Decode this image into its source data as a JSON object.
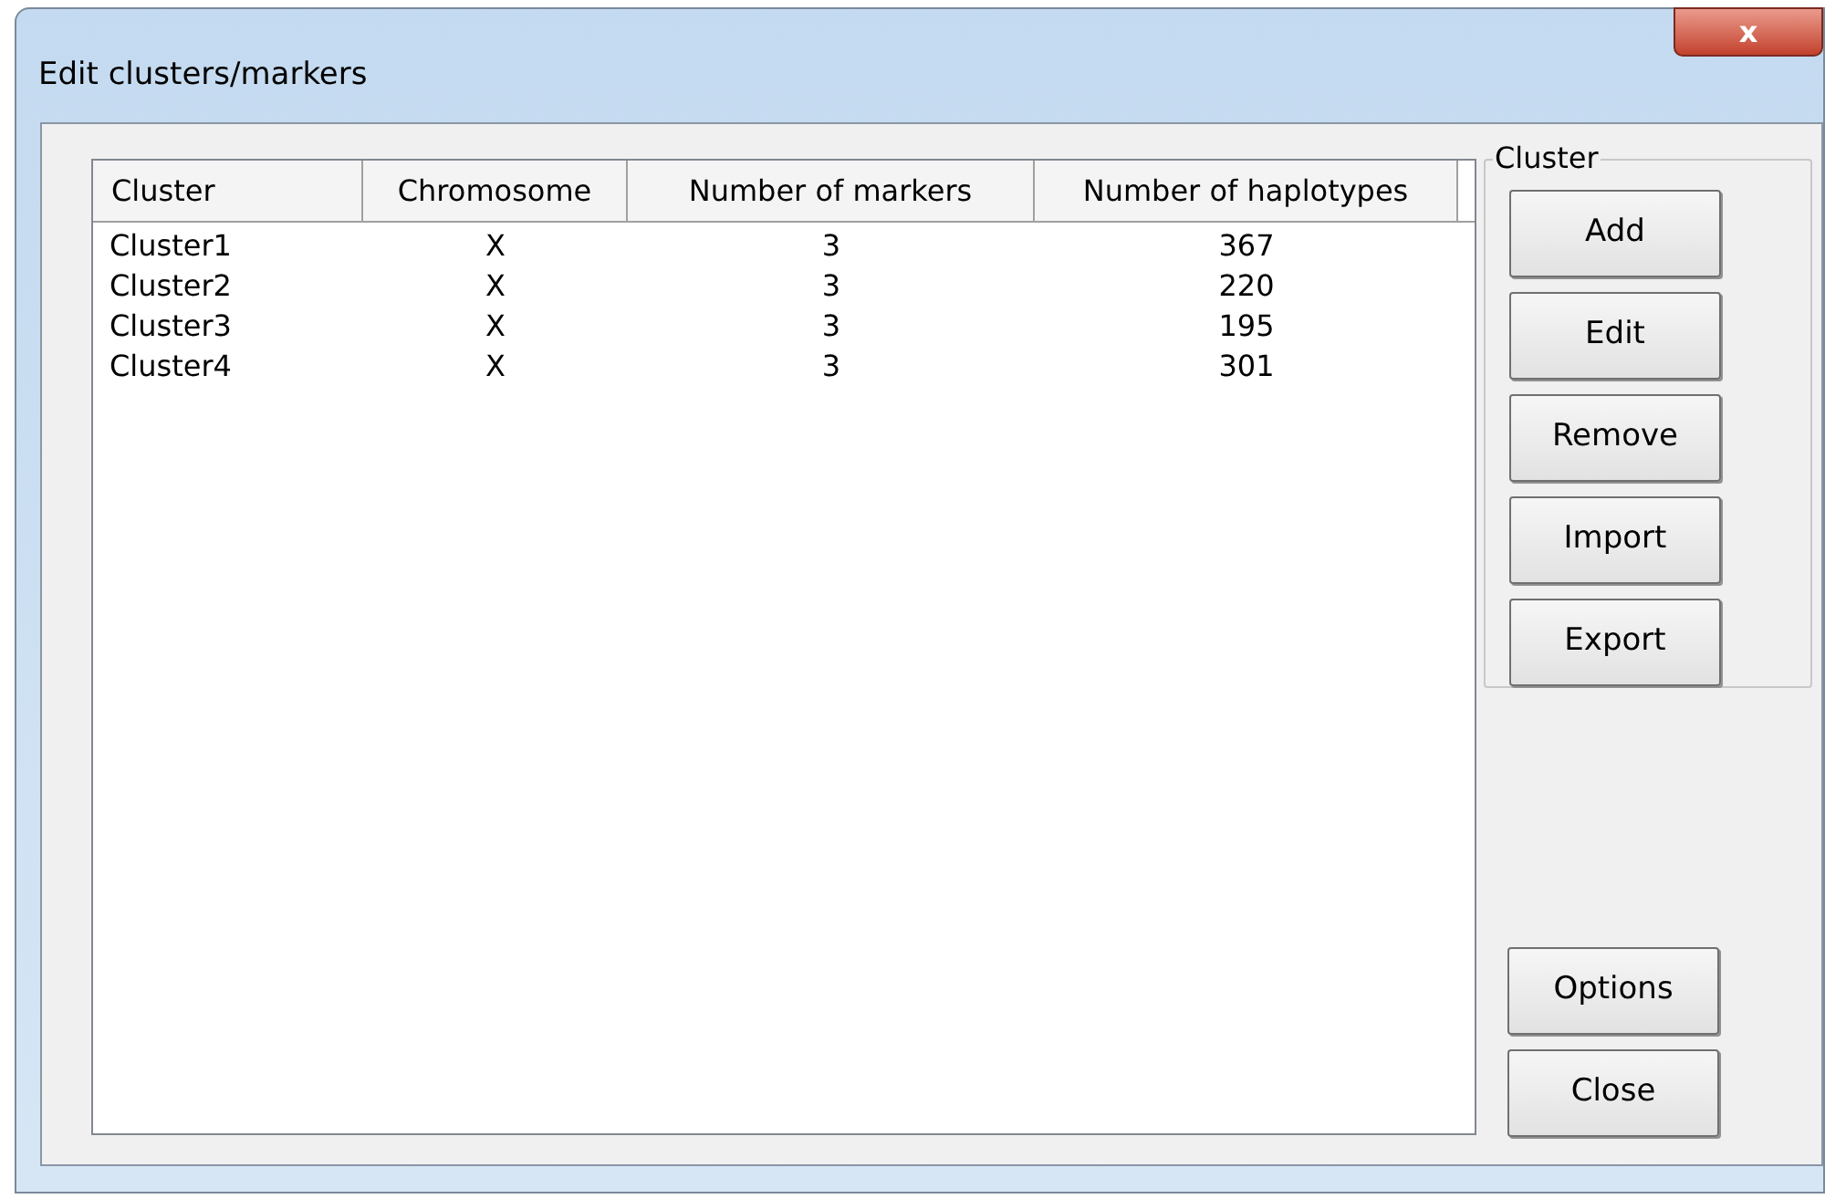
{
  "window": {
    "title": "Edit clusters/markers",
    "close_label": "x"
  },
  "table": {
    "columns": [
      "Cluster",
      "Chromosome",
      "Number of markers",
      "Number of haplotypes"
    ],
    "rows": [
      [
        "Cluster1",
        "X",
        "3",
        "367"
      ],
      [
        "Cluster2",
        "X",
        "3",
        "220"
      ],
      [
        "Cluster3",
        "X",
        "3",
        "195"
      ],
      [
        "Cluster4",
        "X",
        "3",
        "301"
      ]
    ]
  },
  "cluster_group": {
    "title": "Cluster",
    "buttons": [
      "Add",
      "Edit",
      "Remove",
      "Import",
      "Export"
    ]
  },
  "buttons": [
    "Options",
    "Close"
  ]
}
